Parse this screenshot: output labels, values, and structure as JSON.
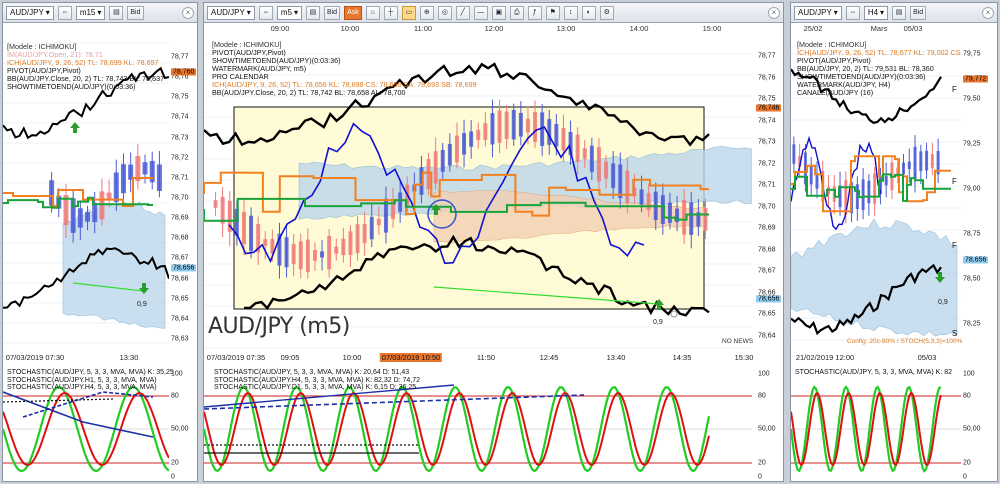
{
  "panels": {
    "left": {
      "symbol": "AUD/JPY",
      "timeframe": "m15",
      "bid_label": "Bid",
      "legend": [
        {
          "text": "[Modele : ICHIMOKU]",
          "color": "#333333"
        },
        {
          "text": "IM(AUD/JPY.Open, 21): 78,71",
          "color": "#e9a0a0"
        },
        {
          "text": "ICH(AUD/JPY, 9, 26, 52)  TL: 78,699  KL: 78,697",
          "color": "#e07a20"
        },
        {
          "text": "PIVOT(AUD/JPY,Pivot)",
          "color": "#111111"
        },
        {
          "text": "BB(AUD/JPY.Close, 20, 2)  TL: 78,743  BL: 78,637",
          "color": "#111111"
        },
        {
          "text": "SHOWTIMETOEND(AUD/JPY)(0:03:36)",
          "color": "#111111"
        }
      ],
      "y_ticks": [
        "78,77",
        "78,76",
        "78,75",
        "78,74",
        "78,73",
        "78,72",
        "78,71",
        "78,70",
        "78,69",
        "78,68",
        "78,67",
        "78,66",
        "78,65",
        "78,64",
        "78,63"
      ],
      "badge_top": "78,760",
      "badge_bottom": "78,656",
      "arrow_label": "0,9",
      "time_axis": [
        "07/03/2019 07:30",
        "13:30"
      ],
      "osc_legend": [
        "STOCHASTIC(AUD/JPY, 5, 3, 3, MVA, MVA)  K: 35,25",
        "STOCHASTIC(AUD/JPY.H1, 5, 3, 3, MVA, MVA)",
        "STOCHASTIC(AUD/JPY.H4, 5, 3, 3, MVA, MVA)"
      ],
      "osc_ticks": [
        "100",
        "80",
        "50,00",
        "20",
        "0"
      ]
    },
    "center": {
      "symbol": "AUD/JPY",
      "timeframe": "m5",
      "bid_label": "Bid",
      "ask_label": "Ask",
      "legend": [
        {
          "text": "[Modele : ICHIMOKU]",
          "color": "#333333"
        },
        {
          "text": "PIVOT(AUD/JPY,Pivot)",
          "color": "#111111"
        },
        {
          "text": "SHOWTIMETOEND(AUD/JPY)(0:03:36)",
          "color": "#111111"
        },
        {
          "text": "WATERMARK(AUD/JPY, m5)",
          "color": "#111111"
        },
        {
          "text": "PRO CALENDAR",
          "color": "#111111"
        },
        {
          "text": "ICH(AUD/JPY, 9, 26, 52)  TL: 78,656  KL: 78,698  CS: 78,656  SA: 78,693  SB: 78,699",
          "color": "#e07a20"
        },
        {
          "text": "BB(AUD/JPY.Close, 20, 2)  TL: 78,742  BL: 78,658  AL: 78,700",
          "color": "#111111"
        }
      ],
      "top_times": [
        "09:00",
        "10:00",
        "11:00",
        "12:00",
        "13:00",
        "14:00",
        "15:00"
      ],
      "y_ticks": [
        "78,77",
        "78,76",
        "78,75",
        "78,74",
        "78,73",
        "78,72",
        "78,71",
        "78,70",
        "78,69",
        "78,68",
        "78,67",
        "78,66",
        "78,65",
        "78,64"
      ],
      "badge_top": "78,746",
      "badge_bottom": "78,656",
      "watermark": "AUD/JPY (m5)",
      "no_news": "NO NEWS",
      "arrow_label": "0,9",
      "time_axis": [
        "07/03/2019 07:35",
        "09:05",
        "10:00",
        "07/03/2019 10:50",
        "11:50",
        "12:45",
        "13:40",
        "14:35",
        "15:30"
      ],
      "osc_legend": [
        "STOCHASTIC(AUD/JPY, 5, 3, 3, MVA, MVA)  K: 20,64  D: 51,43",
        "STOCHASTIC(AUD/JPY.H4, 5, 3, 3, MVA, MVA)  K: 82,32  D: 74,72",
        "STOCHASTIC(AUD/JPY.D1, 5, 3, 3, MVA, MVA)  K: 6,15  D: 36,25"
      ],
      "osc_ticks": [
        "100",
        "80",
        "50,00",
        "20",
        "0"
      ]
    },
    "right": {
      "symbol": "AUD/JPY",
      "timeframe": "H4",
      "bid_label": "Bid",
      "legend": [
        {
          "text": "[Modele : ICHIMOKU]",
          "color": "#333333"
        },
        {
          "text": "ICH(AUD/JPY, 9, 26, 52)  TL: 78,677  KL: 79,002  CS",
          "color": "#e07a20"
        },
        {
          "text": "PIVOT(AUD/JPY,Pivot)",
          "color": "#111111"
        },
        {
          "text": "BB(AUD/JPY, 20, 2)  TL: 79,531  BL: 78,360",
          "color": "#111111"
        },
        {
          "text": "SHOWTIMETOEND(AUD/JPY)(0:03:36)",
          "color": "#111111"
        },
        {
          "text": "WATERMARK(AUD/JPY, H4)",
          "color": "#111111"
        },
        {
          "text": "CANALE(AUD/JPY (16)",
          "color": "#111111"
        }
      ],
      "top_times": [
        "25/02",
        "Mars",
        "05/03"
      ],
      "y_ticks": [
        "79,75",
        "79,50",
        "79,25",
        "79,00",
        "78,75",
        "78,50",
        "78,25"
      ],
      "badge_top": "79,772",
      "badge_bottom": "78,656",
      "arrow_label": "0,9",
      "config_note": "Config: 20c-80% / STOCH(5,3,3)=100%",
      "time_axis": [
        "21/02/2019 12:00",
        "05/03"
      ],
      "osc_legend": [
        "STOCHASTIC(AUD/JPY, 5, 3, 3, MVA, MVA)  K: 82"
      ],
      "osc_ticks": [
        "100",
        "80",
        "50,00",
        "20",
        "0"
      ]
    }
  },
  "colors": {
    "bull": "#4a5bd6",
    "bear": "#f07a7a",
    "tenkan": "#f08020",
    "kijun": "#18a33a",
    "bollinger": "#000000",
    "chikou": "#1010d0",
    "kumo_up": "#bcd6ea",
    "kumo_down": "#f3cfb4",
    "stoch_k": "#22cc22",
    "stoch_d": "#dd1111",
    "level": "#cc2222",
    "box_fill": "#fffbd6"
  }
}
